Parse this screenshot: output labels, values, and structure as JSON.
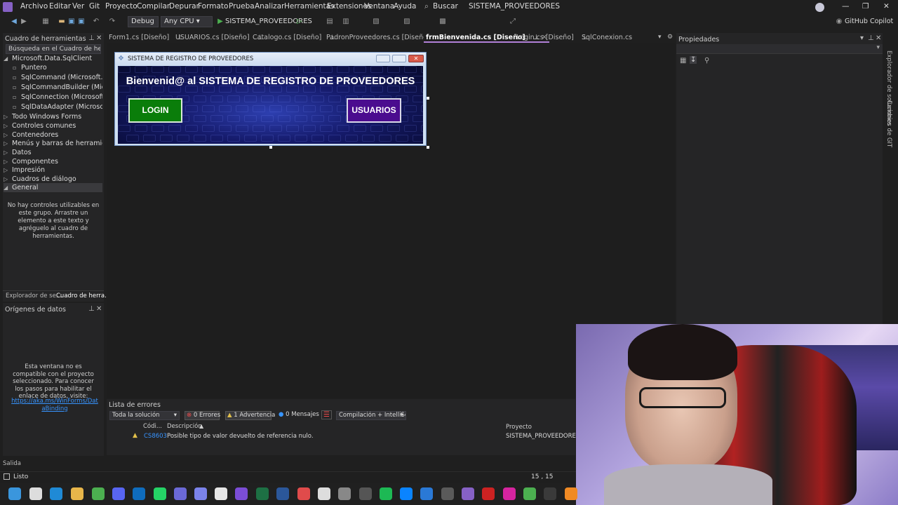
{
  "menu": [
    "Archivo",
    "Editar",
    "Ver",
    "Git",
    "Proyecto",
    "Compilar",
    "Depurar",
    "Formato",
    "Prueba",
    "Analizar",
    "Herramientas",
    "Extensiones",
    "Ventana",
    "Ayuda"
  ],
  "search_label": "Buscar",
  "solution_name": "SISTEMA_PROVEEDORES",
  "toolbar": {
    "config": "Debug",
    "platform": "Any CPU",
    "start_label": "SISTEMA_PROVEEDORES"
  },
  "copilot": "GitHub Copilot",
  "toolbox": {
    "title": "Cuadro de herramientas",
    "search_placeholder": "Búsqueda en el Cuadro de herra",
    "items": [
      {
        "label": "Microsoft.Data.SqlClient",
        "kind": "group-open"
      },
      {
        "label": "Puntero",
        "kind": "child"
      },
      {
        "label": "SqlCommand (Microsoft.Da...",
        "kind": "child"
      },
      {
        "label": "SqlCommandBuilder (Micro...",
        "kind": "child"
      },
      {
        "label": "SqlConnection (Microsoft.D...",
        "kind": "child"
      },
      {
        "label": "SqlDataAdapter (Microsoft....",
        "kind": "child"
      },
      {
        "label": "Todo Windows Forms",
        "kind": "group"
      },
      {
        "label": "Controles comunes",
        "kind": "group"
      },
      {
        "label": "Contenedores",
        "kind": "group"
      },
      {
        "label": "Menús y barras de herramientas",
        "kind": "group"
      },
      {
        "label": "Datos",
        "kind": "group"
      },
      {
        "label": "Componentes",
        "kind": "group"
      },
      {
        "label": "Impresión",
        "kind": "group"
      },
      {
        "label": "Cuadros de diálogo",
        "kind": "group"
      },
      {
        "label": "General",
        "kind": "group-open-sel"
      }
    ],
    "empty_msg": "No hay controles utilizables en este grupo. Arrastre un elemento a este texto y agréguelo al cuadro de herramientas.",
    "bottom_tabs": [
      "Explorador de se...",
      "Cuadro de herra..."
    ]
  },
  "datasources": {
    "title": "Orígenes de datos",
    "msg": "Esta ventana no es compatible con el proyecto seleccionado. Para conocer los pasos para habilitar el enlace de datos, visite:",
    "link": "https://aka.ms/WinForms/DataBinding"
  },
  "doc_tabs": [
    {
      "label": "Form1.cs [Diseño]",
      "active": false
    },
    {
      "label": "USUARIOS.cs [Diseño]",
      "active": false
    },
    {
      "label": "Catalogo.cs [Diseño]",
      "active": false
    },
    {
      "label": "PadronProveedores.cs [Diseño]",
      "active": false
    },
    {
      "label": "frmBienvenida.cs [Diseño]",
      "active": true
    },
    {
      "label": "Login.cs [Diseño]",
      "active": false
    },
    {
      "label": "SqlConexion.cs",
      "active": false
    }
  ],
  "form": {
    "title": "SISTEMA DE REGISTRO DE PROVEEDORES",
    "heading": "Bienvenid@ al SISTEMA DE REGISTRO DE PROVEEDORES",
    "login_label": "LOGIN",
    "usuarios_label": "USUARIOS",
    "login_color": "#0a7d0a",
    "usuarios_color": "#4b0c8f"
  },
  "properties": {
    "title": "Propiedades"
  },
  "side_tabs": [
    "Explorador de soluciones",
    "Cambios de GIT"
  ],
  "errors": {
    "title": "Lista de errores",
    "scope": "Toda la solución",
    "errors_label": "0 Errores",
    "warnings_label": "1 Advertencia",
    "messages_label": "0 Mensajes",
    "filter": "Compilación + IntelliSen",
    "cols": [
      "Códi...",
      "Descripción",
      "Proyecto"
    ],
    "rows": [
      {
        "code": "CS8603",
        "desc": "Posible tipo de valor devuelto de referencia nulo.",
        "project": "SISTEMA_PROVEEDORES"
      }
    ]
  },
  "output_label": "Salida",
  "status": {
    "ready": "Listo",
    "position": "15 , 15"
  }
}
